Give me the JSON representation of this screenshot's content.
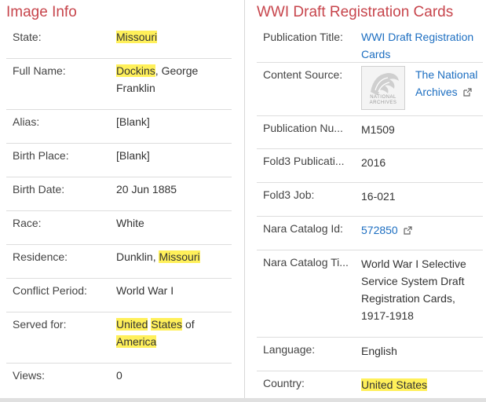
{
  "left_panel": {
    "title": "Image Info",
    "rows": [
      {
        "label": "State:",
        "value": [
          {
            "text": "Missouri",
            "hl": true
          }
        ]
      },
      {
        "label": "Full Name:",
        "value": [
          {
            "text": "Dockins",
            "hl": true
          },
          {
            "text": ", George Franklin",
            "hl": false
          }
        ]
      },
      {
        "label": "Alias:",
        "value": [
          {
            "text": "[Blank]",
            "hl": false
          }
        ]
      },
      {
        "label": "Birth Place:",
        "value": [
          {
            "text": "[Blank]",
            "hl": false
          }
        ]
      },
      {
        "label": "Birth Date:",
        "value": [
          {
            "text": "20 Jun 1885",
            "hl": false
          }
        ]
      },
      {
        "label": "Race:",
        "value": [
          {
            "text": "White",
            "hl": false
          }
        ]
      },
      {
        "label": "Residence:",
        "value": [
          {
            "text": "Dunklin, ",
            "hl": false
          },
          {
            "text": "Missouri",
            "hl": true
          }
        ]
      },
      {
        "label": "Conflict Period:",
        "value": [
          {
            "text": "World War I",
            "hl": false
          }
        ]
      },
      {
        "label": "Served for:",
        "value": [
          {
            "text": "United",
            "hl": true
          },
          {
            "text": " ",
            "hl": false
          },
          {
            "text": "States",
            "hl": true
          },
          {
            "text": " of ",
            "hl": false
          },
          {
            "text": "America",
            "hl": true
          }
        ]
      },
      {
        "label": "Views:",
        "value": [
          {
            "text": "0",
            "hl": false
          }
        ]
      }
    ]
  },
  "right_panel": {
    "title": "WWI Draft Registration Cards",
    "publication_title": {
      "label": "Publication Title:",
      "value": "WWI Draft Registration Cards"
    },
    "content_source": {
      "label": "Content Source:",
      "logo_text_1": "NATIONAL",
      "logo_text_2": "ARCHIVES",
      "value": "The National Archives",
      "icon": "external-link-icon"
    },
    "publication_number": {
      "label": "Publication Nu...",
      "value": "M1509"
    },
    "fold3_publication": {
      "label": "Fold3 Publicati...",
      "value": "2016"
    },
    "fold3_job": {
      "label": "Fold3 Job:",
      "value": "16-021"
    },
    "nara_catalog_id": {
      "label": "Nara Catalog Id:",
      "value": "572850",
      "icon": "external-link-icon"
    },
    "nara_catalog_title": {
      "label": "Nara Catalog Ti...",
      "value": "World War I Selective Service System Draft Registration Cards, 1917-1918"
    },
    "language": {
      "label": "Language:",
      "value": "English"
    },
    "country": {
      "label": "Country:",
      "value": [
        {
          "text": "United",
          "hl": true
        },
        {
          "text": " ",
          "hl": true
        },
        {
          "text": "States",
          "hl": true
        }
      ]
    }
  },
  "colors": {
    "title": "#c7454c",
    "link": "#1c6ec1",
    "highlight": "#fff05a",
    "divider": "#dddddd"
  }
}
